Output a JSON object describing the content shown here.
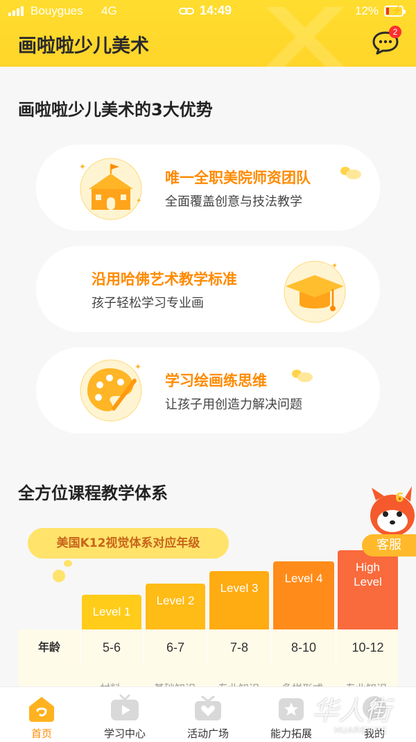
{
  "status_bar": {
    "carrier": "Bouygues",
    "network": "4G",
    "time": "14:49",
    "battery": "12%"
  },
  "header": {
    "title": "画啦啦少儿美术",
    "message_badge": "2"
  },
  "advantages": {
    "title": "画啦啦少儿美术的3大优势",
    "cards": [
      {
        "headline": "唯一全职美院师资团队",
        "sub": "全面覆盖创意与技法教学",
        "icon": "school-icon"
      },
      {
        "headline": "沿用哈佛艺术教学标准",
        "sub": "孩子轻松学习专业画",
        "icon": "graduation-cap-icon"
      },
      {
        "headline": "学习绘画练思维",
        "sub": "让孩子用创造力解决问题",
        "icon": "palette-icon"
      }
    ]
  },
  "curriculum": {
    "title": "全方位课程教学体系",
    "k12_label": "美国K12视觉体系对应年级",
    "levels": [
      "Level 1",
      "Level 2",
      "Level 3",
      "Level 4",
      "High Level"
    ],
    "age_header": "年龄",
    "ages": [
      "5-6",
      "6-7",
      "7-8",
      "8-10",
      "10-12"
    ],
    "partial_row": [
      "材料",
      "基础知识",
      "专业知识",
      "多样形式",
      "专业知识"
    ]
  },
  "customer_service": {
    "label": "客服"
  },
  "tabbar": {
    "items": [
      {
        "label": "首页",
        "icon": "home-icon"
      },
      {
        "label": "学习中心",
        "icon": "play-icon"
      },
      {
        "label": "活动广场",
        "icon": "gift-heart-icon"
      },
      {
        "label": "能力拓展",
        "icon": "star-badge-icon"
      },
      {
        "label": "我的",
        "icon": "profile-icon"
      }
    ]
  },
  "colors": {
    "brand_yellow": "#ffd52a",
    "accent_orange": "#ff8a00",
    "level_colors": [
      "#ffcc1a",
      "#ffbb16",
      "#ffab12",
      "#ff8c1a",
      "#f96a3c"
    ]
  }
}
